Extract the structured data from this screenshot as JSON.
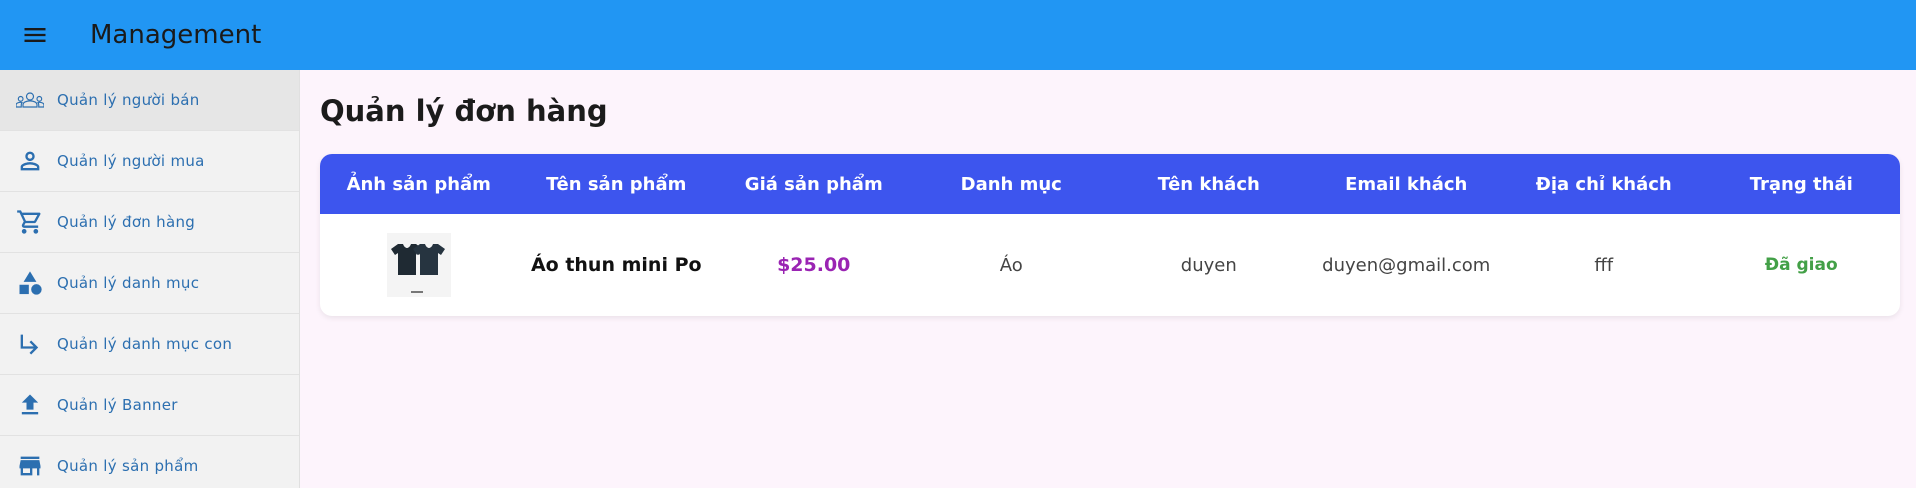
{
  "app": {
    "title": "Management"
  },
  "sidebar": {
    "items": [
      {
        "label": "Quản lý người bán",
        "icon": "group-icon",
        "active": true
      },
      {
        "label": "Quản lý người mua",
        "icon": "person-icon"
      },
      {
        "label": "Quản lý đơn hàng",
        "icon": "cart-icon"
      },
      {
        "label": "Quản lý danh mục",
        "icon": "shapes-icon"
      },
      {
        "label": "Quản lý danh mục con",
        "icon": "subdirectory-arrow-icon"
      },
      {
        "label": "Quản lý Banner",
        "icon": "upload-icon"
      },
      {
        "label": "Quản lý sản phẩm",
        "icon": "store-icon"
      }
    ]
  },
  "main": {
    "title": "Quản lý đơn hàng",
    "table": {
      "headers": [
        "Ảnh sản phẩm",
        "Tên sản phẩm",
        "Giá sản phẩm",
        "Danh mục",
        "Tên khách",
        "Email khách",
        "Địa chỉ khách",
        "Trạng thái"
      ],
      "rows": [
        {
          "image": "t-shirt-product-thumbnail",
          "product_name": "Áo thun mini Po",
          "price": "$25.00",
          "category": "Áo",
          "customer_name": "duyen",
          "customer_email": "duyen@gmail.com",
          "customer_address": "fff",
          "status": "Đã giao"
        }
      ]
    }
  },
  "colors": {
    "appbar": "#2196f3",
    "table_header": "#3d55ee",
    "price": "#9a24b3",
    "status_delivered": "#43a047",
    "sidebar_text": "#2c6fb0"
  }
}
